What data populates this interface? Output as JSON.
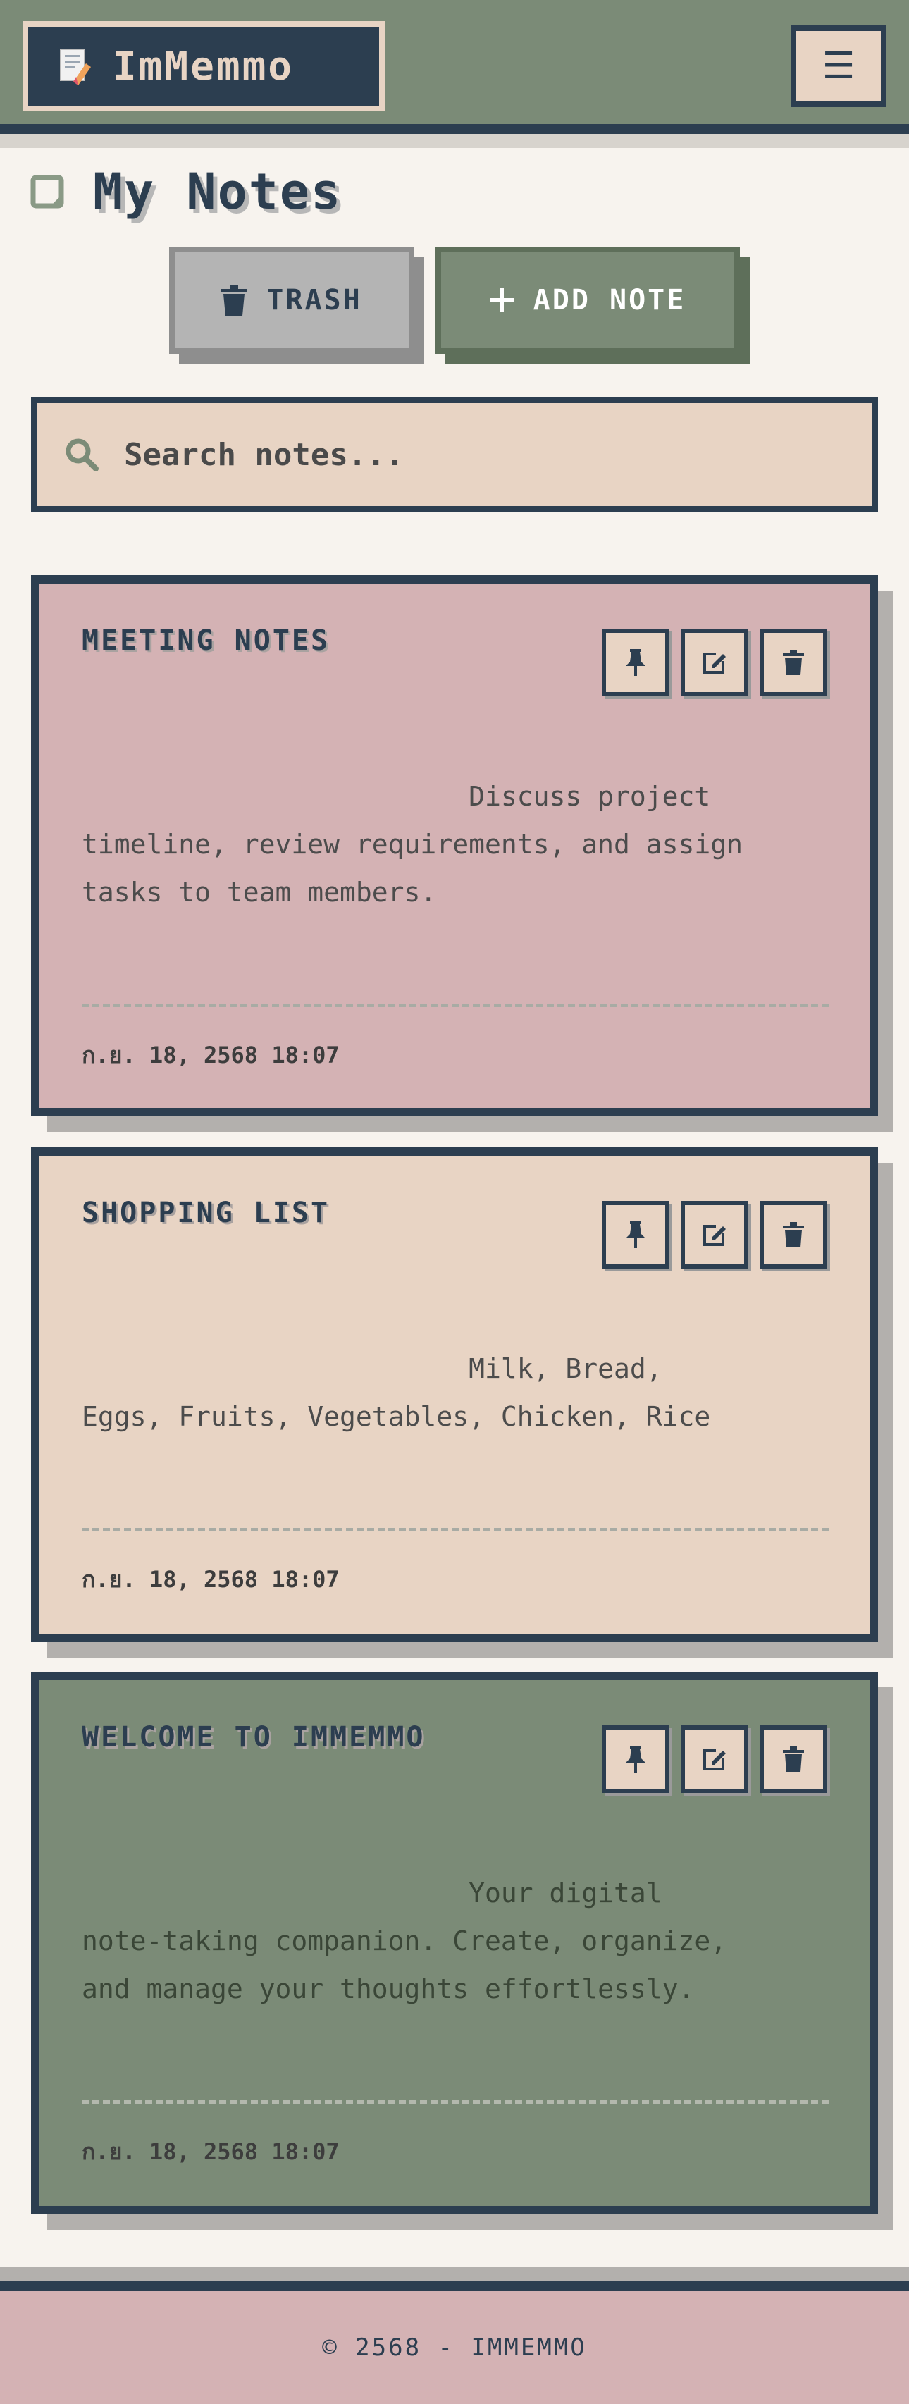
{
  "header": {
    "app_name": "ImMemmo",
    "logo_icon": "notepad-pencil-icon",
    "menu_icon": "hamburger-menu-icon",
    "menu_glyph": "☰"
  },
  "page": {
    "title": "My Notes",
    "title_icon": "note-square-icon"
  },
  "actions": {
    "trash_label": "TRASH",
    "trash_icon": "trash-icon",
    "add_label": "ADD NOTE",
    "add_icon": "plus-icon"
  },
  "search": {
    "placeholder": "Search notes...",
    "value": "",
    "icon": "search-icon"
  },
  "notes": [
    {
      "title": "MEETING NOTES",
      "body": "                        Discuss project\ntimeline, review requirements, and assign\ntasks to team members.",
      "date": "ก.ย. 18, 2568 18:07",
      "color": "#d4b2b4"
    },
    {
      "title": "SHOPPING LIST",
      "body": "                        Milk, Bread,\nEggs, Fruits, Vegetables, Chicken, Rice",
      "date": "ก.ย. 18, 2568 18:07",
      "color": "#e8d4c4"
    },
    {
      "title": "WELCOME TO IMMEMMO",
      "body": "                        Your digital\nnote-taking companion. Create, organize,\nand manage your thoughts effortlessly.",
      "date": "ก.ย. 18, 2568 18:07",
      "color": "#7b8b77"
    }
  ],
  "card_actions": {
    "pin_icon": "pin-icon",
    "edit_icon": "edit-icon",
    "delete_icon": "trash-icon"
  },
  "footer": {
    "text": "© 2568 - IMMEMMO"
  },
  "colors": {
    "navy": "#2c3e50",
    "sage": "#7b8b77",
    "sand": "#e8d4c4",
    "rose": "#d4b2b4",
    "background": "#f7f3ee"
  }
}
